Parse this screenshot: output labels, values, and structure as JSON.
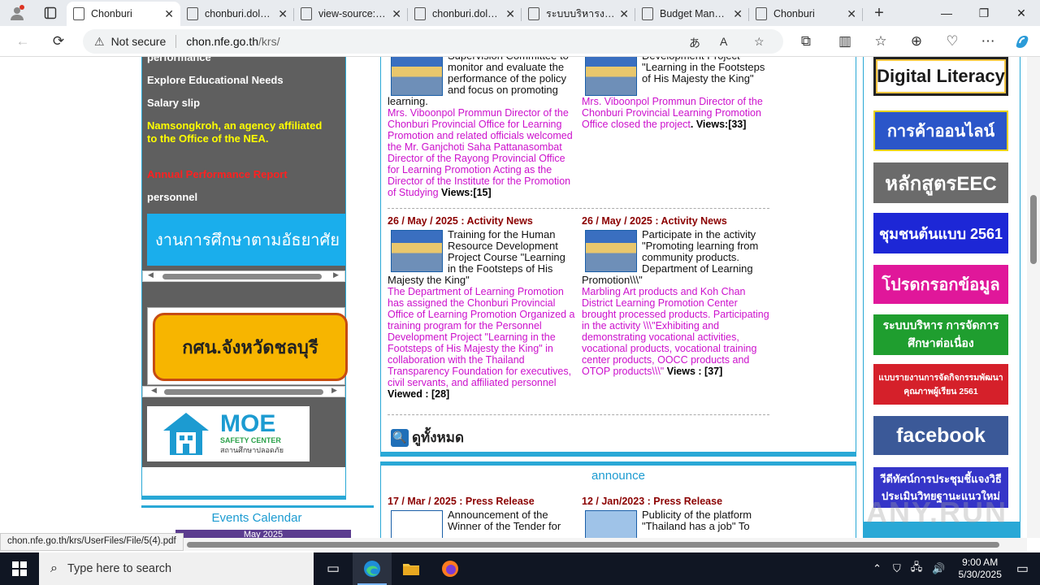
{
  "browser": {
    "tabs": [
      {
        "title": "Chonburi",
        "active": true
      },
      {
        "title": "chonburi.dole.go.th",
        "active": false
      },
      {
        "title": "view-source:chon",
        "active": false
      },
      {
        "title": "chonburi.dole.go.th",
        "active": false
      },
      {
        "title": "ระบบบริหารงบประมาณ",
        "active": false
      },
      {
        "title": "Budget Management",
        "active": false
      },
      {
        "title": "Chonburi",
        "active": false
      }
    ],
    "security_label": "Not secure",
    "url_host": "chon.nfe.go.th",
    "url_path": "/krs/"
  },
  "left_menu": {
    "items": [
      {
        "label": "performance",
        "color": "white"
      },
      {
        "label": "Explore Educational Needs",
        "color": "white"
      },
      {
        "label": "Salary slip",
        "color": "white"
      },
      {
        "label": "Namsongkroh, an agency affiliated to the Office of the NEA.",
        "color": "yellow"
      },
      {
        "label": "Annual Performance Report",
        "color": "red"
      },
      {
        "label": "personnel",
        "color": "white"
      }
    ],
    "banner_edu": "งานการศึกษาตามอัธยาศัย",
    "kor_banner": "กศน.จังหวัดชลบุรี",
    "moe": {
      "title": "MOE",
      "sub1": "SAFETY CENTER",
      "sub2": "สถานศึกษาปลอดภัย"
    },
    "events_title": "Events Calendar",
    "calendar_month": "May 2025"
  },
  "news": {
    "row1": [
      {
        "title": "Supervision Committee to monitor and evaluate the performance of the policy and focus on promoting learning.",
        "desc": "Mrs. Viboonpol Prommun Director of the Chonburi Provincial Office for Learning Promotion and related officials welcomed the Mr. Ganjchoti Saha Pattanasombat Director of the Rayong Provincial Office for Learning Promotion Acting as the Director of the Institute for the Promotion of Studying",
        "views": "Views:[15]"
      },
      {
        "title": "Development Project \"Learning in the Footsteps of His Majesty the King\"",
        "desc": "Mrs. Viboonpol Prommun Director of the Chonburi Provincial Learning Promotion Office closed the project",
        "views": ". Views:[33]"
      }
    ],
    "row2": [
      {
        "date": "26 / May / 2025 : Activity News",
        "title": "Training for the Human Resource Development Project Course \"Learning in the Footsteps of His Majesty the King\"",
        "desc": "The Department of Learning Promotion has assigned the Chonburi Provincial Office of Learning Promotion Organized a training program for the Personnel Development Project \"Learning in the Footsteps of His Majesty the King\" in collaboration with the Thailand Transparency Foundation for executives, civil servants, and affiliated personnel",
        "views": "Viewed : [28]"
      },
      {
        "date": "26 / May / 2025 : Activity News",
        "title": "Participate in the activity \"Promoting learning from community products. Department of Learning Promotion\\\\\\\"",
        "desc": "Marbling Art products and Koh Chan District Learning Promotion Center brought processed products. Participating in the activity \\\\\\\"Exhibiting and demonstrating vocational activities, vocational products, vocational training center products, OOCC products and OTOP products\\\\\\\"",
        "views": " Views : [37]"
      }
    ],
    "see_all": "ดูทั้งหมด"
  },
  "announce": {
    "title": "announce",
    "items": [
      {
        "date": "17 / Mar / 2025 : Press Release",
        "title": "Announcement of the Winner of the Tender for"
      },
      {
        "date": "12 / Jan/2023 : Press Release",
        "title": "Publicity of the platform \"Thailand has a job\" To"
      }
    ]
  },
  "right_banners": [
    {
      "label": "Digital Literacy",
      "bg": "#ffffff",
      "fg": "#1a1a1a"
    },
    {
      "label": "การค้าออนไลน์",
      "bg": "#2b56c9",
      "fg": "#ffffff"
    },
    {
      "label": "หลักสูตรEEC",
      "bg": "#6b6b6b",
      "fg": "#ffffff"
    },
    {
      "label": "ชุมชนต้นแบบ 2561",
      "bg": "#1d27d6",
      "fg": "#ffffff"
    },
    {
      "label": "โปรดกรอกข้อมูล",
      "bg": "#e0179a",
      "fg": "#ffffff"
    },
    {
      "label": "ระบบบริหาร การจัดการศึกษาต่อเนื่อง",
      "bg": "#1f9e2f",
      "fg": "#ffffff"
    },
    {
      "label": "แบบรายงานการจัดกิจกรรมพัฒนาคุณภาพผู้เรียน 2561",
      "bg": "#d5202a",
      "fg": "#ffffff"
    },
    {
      "label": "facebook",
      "bg": "#3b5998",
      "fg": "#ffffff"
    },
    {
      "label": "วีดีทัศน์การประชุมชี้แจงวิธีประเมินวิทยฐานะแนวใหม่",
      "bg": "#3535c8",
      "fg": "#ffffff"
    }
  ],
  "status_url": "chon.nfe.go.th/krs/UserFiles/File/5(4).pdf",
  "watermark": "ANY.RUN",
  "taskbar": {
    "search_placeholder": "Type here to search",
    "time": "9:00 AM",
    "date": "5/30/2025"
  }
}
